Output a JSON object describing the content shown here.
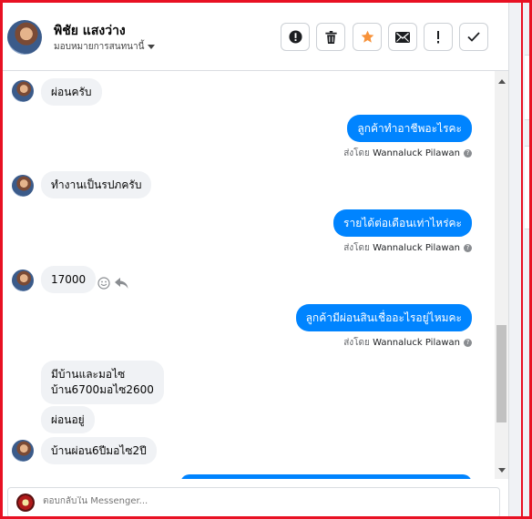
{
  "header": {
    "contact_name": "พิชัย แสงว่าง",
    "assign_label": "มอบหมายการสนทนานี้",
    "actions": [
      {
        "icon": "alert-circle-icon",
        "label": "Mark as spam"
      },
      {
        "icon": "trash-icon",
        "label": "Delete"
      },
      {
        "icon": "star-icon",
        "label": "Follow up"
      },
      {
        "icon": "envelope-icon",
        "label": "Mark as unread"
      },
      {
        "icon": "exclamation-icon",
        "label": "Mark as priority"
      },
      {
        "icon": "check-icon",
        "label": "Mark as done"
      }
    ]
  },
  "messages": [
    {
      "dir": "in",
      "text": "ผ่อนครับ"
    },
    {
      "dir": "out",
      "text": "ลูกค้าทำอาชีพอะไรคะ",
      "sent_by_prefix": "ส่งโดย",
      "sent_by": "Wannaluck Pilawan"
    },
    {
      "dir": "in",
      "text": "ทำงานเป็นรปภครับ"
    },
    {
      "dir": "out",
      "text": "รายได้ต่อเดือนเท่าไหร่คะ",
      "sent_by_prefix": "ส่งโดย",
      "sent_by": "Wannaluck Pilawan"
    },
    {
      "dir": "in",
      "text": "17000"
    },
    {
      "dir": "out",
      "text": "ลูกค้ามีผ่อนสินเชื่ออะไรอยู่ไหมคะ",
      "sent_by_prefix": "ส่งโดย",
      "sent_by": "Wannaluck Pilawan"
    },
    {
      "dir": "in",
      "text_line1": "มีบ้านและมอไซ",
      "text_line2": "บ้าน6700มอไซ2600"
    },
    {
      "dir": "in",
      "text": "ผ่อนอยู่"
    },
    {
      "dir": "in",
      "text": "บ้านผ่อน6ปีมอไซ2ปี"
    }
  ],
  "composer": {
    "placeholder": "ตอบกลับใน Messenger..."
  },
  "colors": {
    "outgoing_bubble": "#0084ff",
    "incoming_bubble": "#f0f2f5",
    "star": "#f7923a",
    "frame": "#e81123"
  }
}
